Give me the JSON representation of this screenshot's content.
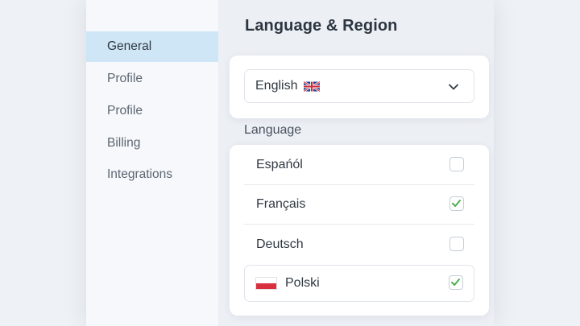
{
  "sidebar": {
    "items": [
      {
        "label": "General",
        "active": true
      },
      {
        "label": "Profile",
        "active": false
      },
      {
        "label": "Profile",
        "active": false
      },
      {
        "label": "Billing",
        "active": false
      },
      {
        "label": "Integrations",
        "active": false
      }
    ]
  },
  "main": {
    "title": "Language & Region",
    "language_select": {
      "value": "English",
      "flag": "uk-flag-icon"
    },
    "section_label": "Language",
    "languages": [
      {
        "label": "Espańól",
        "checked": false
      },
      {
        "label": "Français",
        "checked": true
      },
      {
        "label": "Deutsch",
        "checked": false
      },
      {
        "label": "Polski",
        "checked": true,
        "flag": "poland-flag-icon"
      }
    ]
  },
  "colors": {
    "active_sidebar_bg": "#cfe6f6",
    "check_green": "#4caf50",
    "background": "#eef1f5"
  }
}
